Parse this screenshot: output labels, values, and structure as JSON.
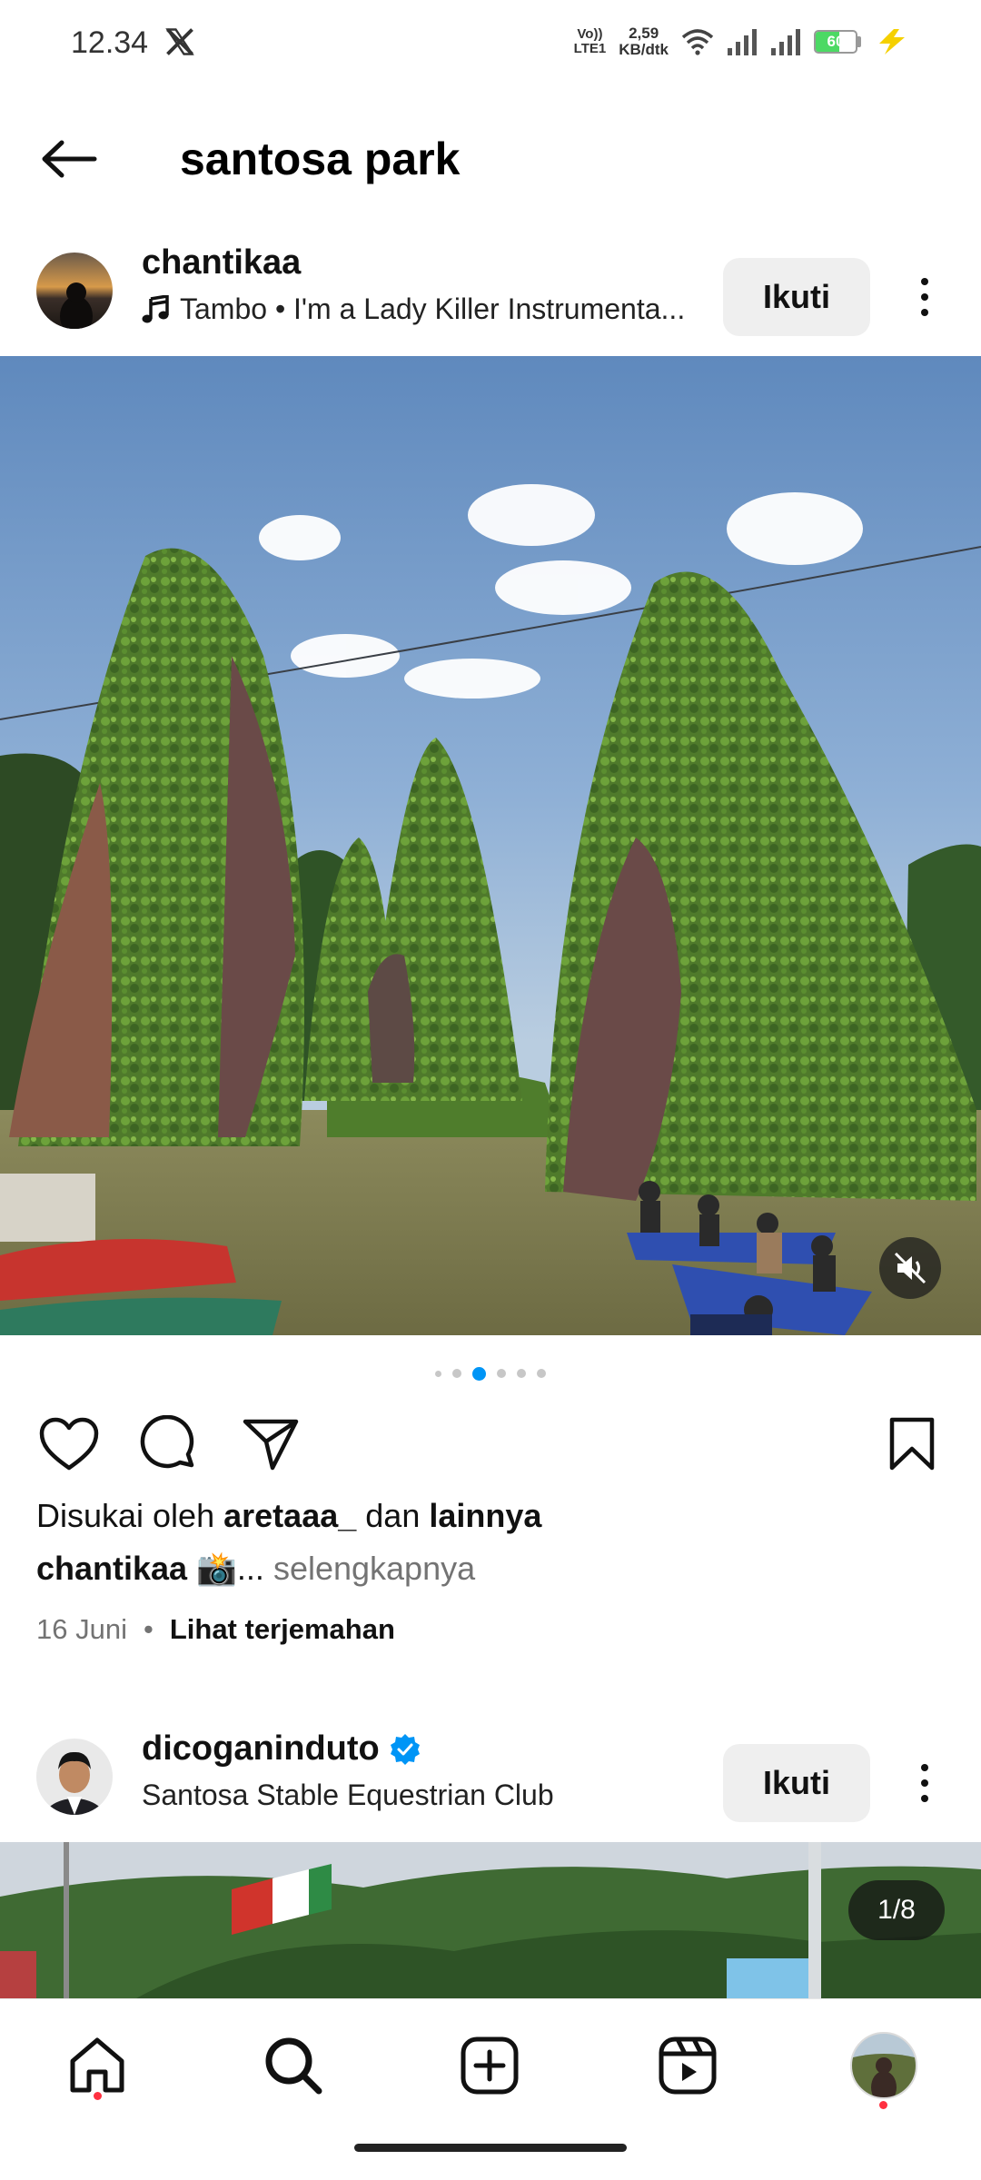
{
  "status_bar": {
    "time": "12.34",
    "network_label_1": "Vo))",
    "network_label_2": "LTE1",
    "speed_value": "2,59",
    "speed_unit": "KB/dtk",
    "battery": "60",
    "battery_level": 0.6
  },
  "header": {
    "title": "santosa park"
  },
  "post1": {
    "username": "chantikaa",
    "music": "Tambo • I'm a Lady Killer Instrumenta...",
    "follow_label": "Ikuti",
    "carousel_pages": 6,
    "carousel_active": 2,
    "likes_prefix": "Disukai oleh",
    "likes_user": "aretaaa_",
    "likes_and": "dan",
    "likes_others": "lainnya",
    "caption_user": "chantikaa",
    "caption_text": "📸...",
    "caption_more": "selengkapnya",
    "date": "16 Juni",
    "separator": "•",
    "translate": "Lihat terjemahan"
  },
  "post2": {
    "username": "dicoganinduto",
    "location": "Santosa Stable Equestrian Club",
    "follow_label": "Ikuti",
    "counter": "1/8"
  },
  "nav": {
    "items": [
      "home-icon",
      "search-icon",
      "create-icon",
      "reels-icon",
      "profile-avatar"
    ]
  }
}
